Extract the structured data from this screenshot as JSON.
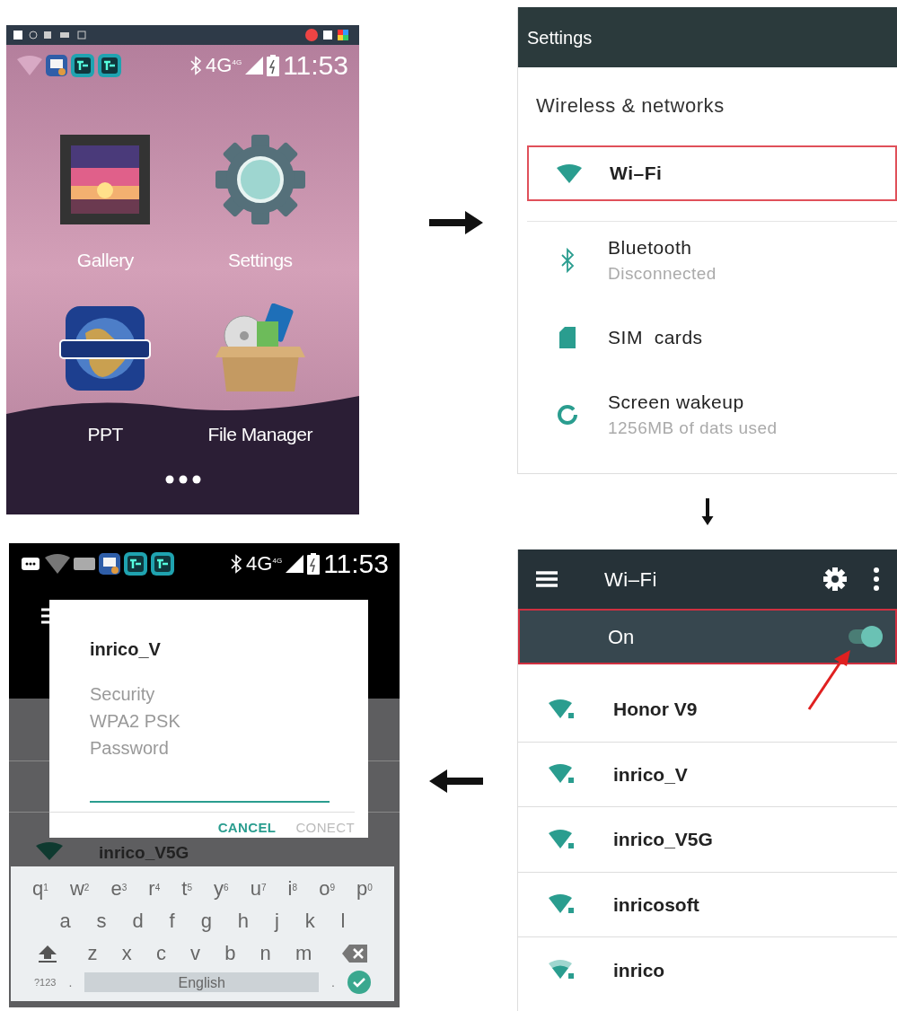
{
  "home_screen": {
    "status_bar": {
      "network": "4G",
      "network_small": "4G",
      "time": "11:53"
    },
    "apps": [
      {
        "label": "Gallery",
        "kind": "gallery"
      },
      {
        "label": "Settings",
        "kind": "settings"
      },
      {
        "label": "PPT",
        "kind": "ppt"
      },
      {
        "label": "File Manager",
        "kind": "files"
      }
    ]
  },
  "settings_screen": {
    "title": "Settings",
    "section": "Wireless & networks",
    "items": [
      {
        "title": "Wi–Fi",
        "kind": "wifi",
        "highlighted": true
      },
      {
        "title": "Bluetooth",
        "subtitle": "Disconnected",
        "kind": "bluetooth",
        "highlighted": false
      },
      {
        "title": "SIM  cards",
        "kind": "sim",
        "highlighted": false
      },
      {
        "title": "Screen wakeup",
        "subtitle": "1256MB of dats used",
        "kind": "data",
        "highlighted": false
      }
    ]
  },
  "wifi_screen": {
    "title": "Wi–Fi",
    "toggle": {
      "label": "On",
      "on": true,
      "highlighted": true
    },
    "networks": [
      {
        "name": "Honor V9",
        "kind": "strong"
      },
      {
        "name": "inrico_V",
        "kind": "strong"
      },
      {
        "name": "inrico_V5G",
        "kind": "strong"
      },
      {
        "name": "inricosoft",
        "kind": "strong"
      },
      {
        "name": "inrico",
        "kind": "weak"
      }
    ]
  },
  "connect_screen": {
    "status_bar": {
      "network": "4G",
      "network_small": "4G",
      "time": "11:53"
    },
    "background_network": "inrico_V5G",
    "dialog": {
      "title": "inrico_V",
      "lines": [
        "Security",
        "WPA2 PSK",
        "Password"
      ],
      "buttons": [
        {
          "label": "CANCEL",
          "disabled": false
        },
        {
          "label": "CONECT",
          "disabled": true
        }
      ]
    },
    "keyboard": {
      "rows": [
        [
          {
            "label": "q",
            "hint": "1"
          },
          {
            "label": "w",
            "hint": "2"
          },
          {
            "label": "e",
            "hint": "3"
          },
          {
            "label": "r",
            "hint": "4"
          },
          {
            "label": "t",
            "hint": "5"
          },
          {
            "label": "y",
            "hint": "6"
          },
          {
            "label": "u",
            "hint": "7"
          },
          {
            "label": "i",
            "hint": "8"
          },
          {
            "label": "o",
            "hint": "9"
          },
          {
            "label": "p",
            "hint": "0"
          }
        ],
        [
          {
            "label": "a"
          },
          {
            "label": "s"
          },
          {
            "label": "d"
          },
          {
            "label": "f"
          },
          {
            "label": "g"
          },
          {
            "label": "h"
          },
          {
            "label": "j"
          },
          {
            "label": "k"
          },
          {
            "label": "l"
          }
        ],
        [
          {
            "label": "z"
          },
          {
            "label": "x"
          },
          {
            "label": "c"
          },
          {
            "label": "v"
          },
          {
            "label": "b"
          },
          {
            "label": "n"
          },
          {
            "label": "m"
          }
        ]
      ],
      "symbols_key": "?123",
      "comma_key": ".",
      "space_key": "English",
      "period_key": "."
    }
  }
}
